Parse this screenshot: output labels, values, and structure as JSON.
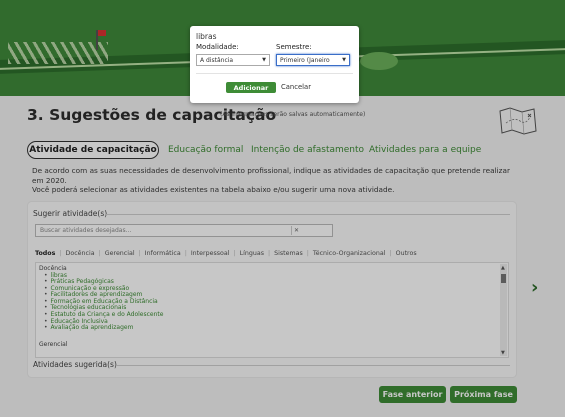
{
  "page": {
    "title": "3. Sugestões de capacitação",
    "autosave_note": "(As informações serão salvas automaticamente)"
  },
  "tabs": [
    {
      "label": "Atividade de capacitação",
      "active": true
    },
    {
      "label": "Educação formal"
    },
    {
      "label": "Intenção de afastamento"
    },
    {
      "label": "Atividades para a equipe"
    }
  ],
  "intro": {
    "line1": "De acordo com as suas necessidades de desenvolvimento profissional, indique as atividades de capacitação que pretende realizar em 2020.",
    "line2": "Você poderá selecionar as atividades existentes na tabela abaixo e/ou sugerir uma nova atividade."
  },
  "suggest": {
    "label": "Sugerir atividade(s)",
    "placeholder": "Buscar atividades desejadas...",
    "clear_symbol": "✕"
  },
  "filters": [
    "Todos",
    "Docência",
    "Gerencial",
    "Informática",
    "Interpessoal",
    "Línguas",
    "Sistemas",
    "Técnico-Organizacional",
    "Outros"
  ],
  "list": {
    "category1": "Docência",
    "items": [
      "libras",
      "Práticas Pedagógicas",
      "Comunicação e expressão",
      "Facilitadores de aprendizagem",
      "Formação em Educação a Distância",
      "Tecnologias educacionais",
      "Estatuto da Criança e do Adolescente",
      "Educação Inclusiva",
      "Avaliação da aprendizagem"
    ],
    "category2": "Gerencial"
  },
  "suggested_label": "Atividades sugerida(s)",
  "buttons": {
    "prev": "Fase anterior",
    "next": "Próxima fase"
  },
  "modal": {
    "activity": "libras",
    "modalidade_label": "Modalidade:",
    "modalidade_value": "A distância",
    "semestre_label": "Semestre:",
    "semestre_value": "Primeiro (Janeiro",
    "add": "Adicionar",
    "cancel": "Cancelar"
  },
  "colors": {
    "accent": "#3e8c36",
    "banner": "#3f8a3a"
  }
}
